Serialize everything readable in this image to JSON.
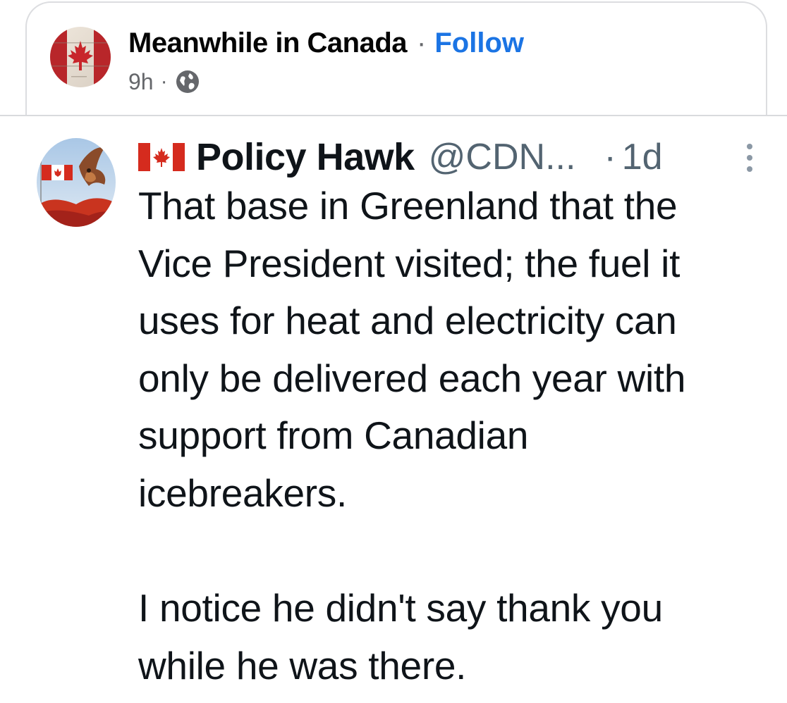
{
  "facebook_post": {
    "page_name": "Meanwhile in Canada",
    "separator": "·",
    "follow_label": "Follow",
    "time": "9h",
    "meta_separator": "·",
    "audience_icon": "globe-icon",
    "avatar_icon": "canada-maple-leaf-avatar"
  },
  "tweet": {
    "flag_icon": "canada-flag-icon",
    "display_name": "Policy Hawk",
    "handle": "@CDN...",
    "separator": "·",
    "age": "1d",
    "more_icon": "vertical-dots-icon",
    "paragraph_1": "That base in Greenland that the\nVice President visited; the fuel it\nuses for heat and electricity can\nonly be delivered each year with\nsupport from Canadian\nicebreakers.",
    "paragraph_2": "I notice he didn't say thank you\nwhile he was there."
  },
  "colors": {
    "follow_blue": "#1b74e4",
    "canada_red": "#d52b1e",
    "muted_gray": "#65676b"
  }
}
